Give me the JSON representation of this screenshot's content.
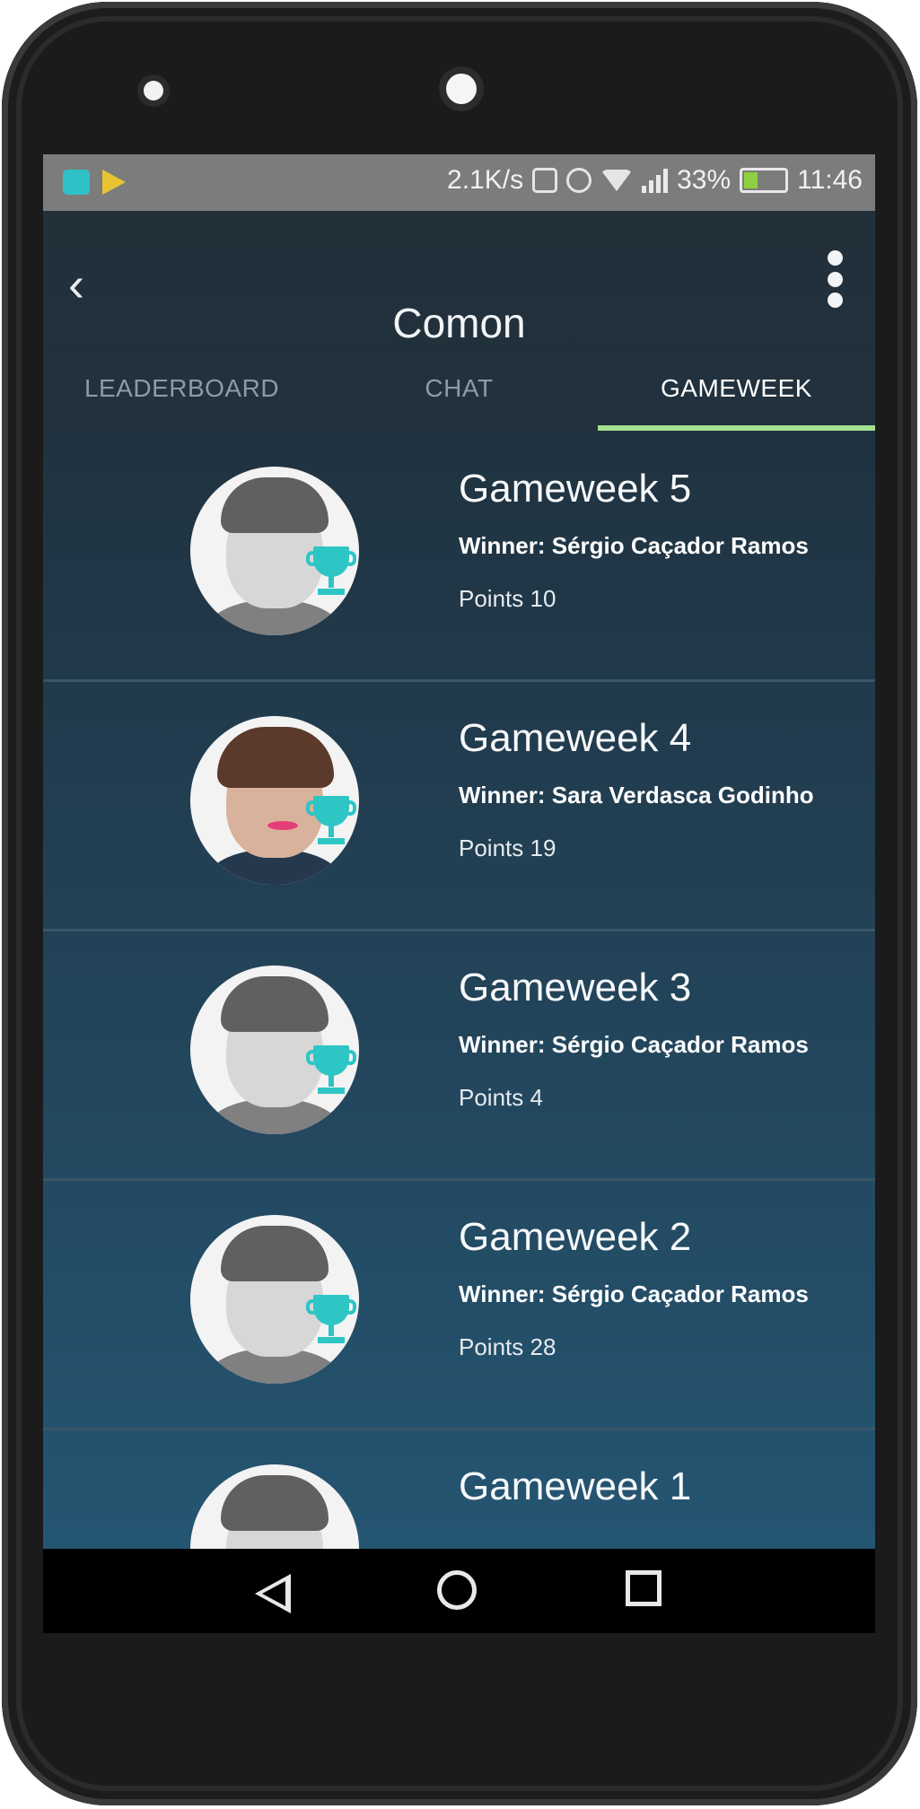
{
  "status_bar": {
    "network_speed": "2.1K/s",
    "battery": "33%",
    "time": "11:46",
    "icons": [
      "app-notification-icon",
      "play-store-icon",
      "vibrate-icon",
      "alarm-icon",
      "wifi-icon",
      "signal-icon",
      "battery-charging-icon"
    ]
  },
  "header": {
    "title": "Comon",
    "back_icon": "chevron-left-icon",
    "menu_icon": "more-vertical-icon"
  },
  "tabs": [
    {
      "label": "LEADERBOARD",
      "active": false
    },
    {
      "label": "CHAT",
      "active": false
    },
    {
      "label": "GAMEWEEK",
      "active": true
    }
  ],
  "gameweeks": [
    {
      "title": "Gameweek 5",
      "winner": "Winner: Sérgio Caçador Ramos",
      "points": "Points 10"
    },
    {
      "title": "Gameweek 4",
      "winner": "Winner: Sara Verdasca Godinho",
      "points": "Points 19"
    },
    {
      "title": "Gameweek 3",
      "winner": "Winner: Sérgio Caçador Ramos",
      "points": "Points 4"
    },
    {
      "title": "Gameweek 2",
      "winner": "Winner: Sérgio Caçador Ramos",
      "points": "Points 28"
    },
    {
      "title": "Gameweek 1",
      "winner": "",
      "points": ""
    }
  ],
  "colors": {
    "tab_indicator": "#a3e08e",
    "trophy": "#2ec5c5",
    "background_top": "#1e2c38",
    "background_bottom": "#255a79"
  },
  "nav_bar": {
    "icons": [
      "back-triangle-icon",
      "home-circle-icon",
      "recent-square-icon"
    ]
  }
}
